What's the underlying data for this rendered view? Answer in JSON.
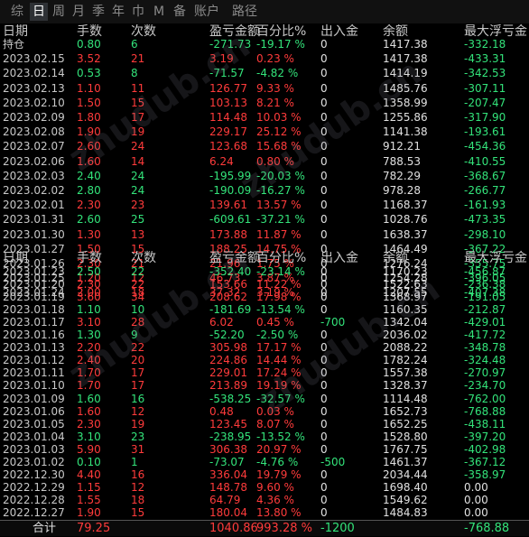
{
  "tabs": [
    "综",
    "日",
    "周",
    "月",
    "季",
    "年",
    "巾",
    "M",
    "备",
    "账户",
    "路径"
  ],
  "active_tab": "日",
  "headers": [
    "日期",
    "手数",
    "次数",
    "盈亏金额",
    "百分比%",
    "出入金",
    "余额",
    "最大浮亏金"
  ],
  "rows1": [
    [
      "持仓",
      "0.80",
      "6",
      "-271.73",
      "-19.17 %",
      "0",
      "1417.38",
      "-332.18"
    ],
    [
      "2023.02.15",
      "3.52",
      "21",
      "3.19",
      "0.23 %",
      "0",
      "1417.38",
      "-433.31"
    ],
    [
      "2023.02.14",
      "0.53",
      "8",
      "-71.57",
      "-4.82 %",
      "0",
      "1414.19",
      "-342.53"
    ],
    [
      "2023.02.13",
      "1.10",
      "11",
      "126.77",
      "9.33 %",
      "0",
      "1485.76",
      "-307.11"
    ],
    [
      "2023.02.10",
      "1.50",
      "15",
      "103.13",
      "8.21 %",
      "0",
      "1358.99",
      "-207.47"
    ],
    [
      "2023.02.09",
      "1.80",
      "17",
      "114.48",
      "10.03 %",
      "0",
      "1255.86",
      "-317.90"
    ],
    [
      "2023.02.08",
      "1.90",
      "19",
      "229.17",
      "25.12 %",
      "0",
      "1141.38",
      "-193.61"
    ],
    [
      "2023.02.07",
      "2.60",
      "24",
      "123.68",
      "15.68 %",
      "0",
      "912.21",
      "-454.36"
    ],
    [
      "2023.02.06",
      "1.60",
      "14",
      "6.24",
      "0.80 %",
      "0",
      "788.53",
      "-410.55"
    ],
    [
      "2023.02.03",
      "2.40",
      "24",
      "-195.99",
      "-20.03 %",
      "0",
      "782.29",
      "-368.67"
    ],
    [
      "2023.02.02",
      "2.80",
      "24",
      "-190.09",
      "-16.27 %",
      "0",
      "978.28",
      "-266.77"
    ],
    [
      "2023.02.01",
      "2.30",
      "23",
      "139.61",
      "13.57 %",
      "0",
      "1168.37",
      "-161.93"
    ],
    [
      "2023.01.31",
      "2.60",
      "25",
      "-609.61",
      "-37.21 %",
      "0",
      "1028.76",
      "-473.35"
    ],
    [
      "2023.01.30",
      "1.30",
      "13",
      "173.88",
      "11.87 %",
      "0",
      "1638.37",
      "-298.10"
    ],
    [
      "2023.01.27",
      "1.50",
      "15",
      "188.25",
      "14.75 %",
      "0",
      "1464.49",
      "-367.22"
    ],
    [
      "2023.01.26",
      "2.30",
      "21",
      "21.96",
      "1.75 %",
      "0",
      "1276.24",
      "-355.75"
    ],
    [
      "2023.01.25",
      "1.20",
      "12",
      "46.73",
      "3.87 %",
      "0",
      "1254.28",
      "-396.05"
    ],
    [
      "2023.01.24",
      "2.00",
      "18",
      "37.32",
      "3.19 %",
      "0",
      "1207.55",
      "-407.38"
    ]
  ],
  "rows2": [
    [
      "2023.01.23",
      "2.50",
      "22",
      "-352.40",
      "-23.14 %",
      "0",
      "1170.23",
      "-456.87"
    ],
    [
      "2023.01.20",
      "2.30",
      "22",
      "153.66",
      "11.22 %",
      "0",
      "1522.63",
      "-236.38"
    ],
    [
      "2023.01.19",
      "3.60",
      "34",
      "208.62",
      "17.98 %",
      "0",
      "1368.97",
      "-191.05"
    ],
    [
      "2023.01.18",
      "1.10",
      "10",
      "-181.69",
      "-13.54 %",
      "0",
      "1160.35",
      "-212.87"
    ],
    [
      "2023.01.17",
      "3.10",
      "28",
      "6.02",
      "0.45 %",
      "-700",
      "1342.04",
      "-429.01"
    ],
    [
      "2023.01.16",
      "1.30",
      "9",
      "-52.20",
      "-2.50 %",
      "0",
      "2036.02",
      "-417.72"
    ],
    [
      "2023.01.13",
      "2.20",
      "22",
      "305.98",
      "17.17 %",
      "0",
      "2088.22",
      "-348.78"
    ],
    [
      "2023.01.12",
      "2.40",
      "20",
      "224.86",
      "14.44 %",
      "0",
      "1782.24",
      "-324.48"
    ],
    [
      "2023.01.11",
      "1.70",
      "17",
      "229.01",
      "17.24 %",
      "0",
      "1557.38",
      "-270.97"
    ],
    [
      "2023.01.10",
      "1.70",
      "17",
      "213.89",
      "19.19 %",
      "0",
      "1328.37",
      "-234.70"
    ],
    [
      "2023.01.09",
      "1.60",
      "16",
      "-538.25",
      "-32.57 %",
      "0",
      "1114.48",
      "-762.00"
    ],
    [
      "2023.01.06",
      "1.60",
      "12",
      "0.48",
      "0.03 %",
      "0",
      "1652.73",
      "-768.88"
    ],
    [
      "2023.01.05",
      "2.30",
      "19",
      "123.45",
      "8.07 %",
      "0",
      "1652.25",
      "-438.11"
    ],
    [
      "2023.01.04",
      "3.10",
      "23",
      "-238.95",
      "-13.52 %",
      "0",
      "1528.80",
      "-397.20"
    ],
    [
      "2023.01.03",
      "5.90",
      "31",
      "306.38",
      "20.97 %",
      "0",
      "1767.75",
      "-402.98"
    ],
    [
      "2023.01.02",
      "0.10",
      "1",
      "-73.07",
      "-4.76 %",
      "-500",
      "1461.37",
      "-367.12"
    ],
    [
      "2022.12.30",
      "4.40",
      "16",
      "336.04",
      "19.79 %",
      "0",
      "2034.44",
      "-358.97"
    ],
    [
      "2022.12.29",
      "1.15",
      "12",
      "148.78",
      "9.60 %",
      "0",
      "1698.40",
      "0.00"
    ],
    [
      "2022.12.28",
      "1.55",
      "18",
      "64.79",
      "4.36 %",
      "0",
      "1549.62",
      "0.00"
    ],
    [
      "2022.12.27",
      "1.90",
      "15",
      "180.04",
      "13.80 %",
      "0",
      "1484.83",
      "0.00"
    ]
  ],
  "total": {
    "label": "合计",
    "lots": "79.25",
    "pnl": "1040.86",
    "pct": "993.28 %",
    "flow": "-1200",
    "float": "-768.88"
  },
  "colors": {
    "red": "#ff3b3b",
    "green": "#33e37a"
  }
}
